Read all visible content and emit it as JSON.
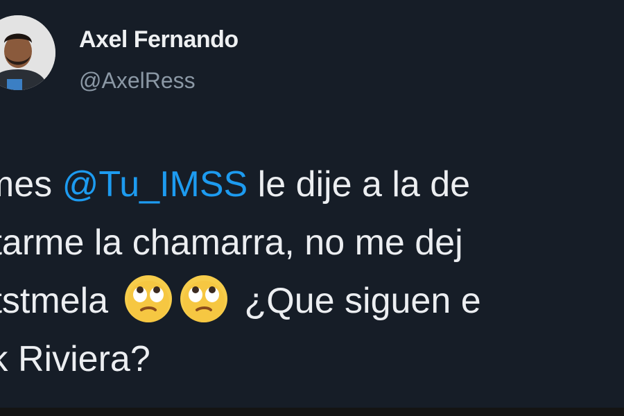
{
  "user": {
    "display_name": "Axel Fernando",
    "handle": "@AxelRess"
  },
  "tweet": {
    "lines": [
      {
        "before": "ames ",
        "mention": "@Tu_IMSS",
        "after": " le dije a la de"
      },
      {
        "text": "uitarme la chamarra, no me dej"
      },
      {
        "before": "uitstmela",
        "emojis": [
          "face-with-rolling-eyes-icon",
          "face-with-rolling-eyes-icon"
        ],
        "after": " ¿Que siguen e"
      },
      {
        "text": "ick Riviera?"
      }
    ]
  },
  "colors": {
    "background": "#161d27",
    "mention": "#1d9bf0",
    "handle": "#8b98a5"
  }
}
